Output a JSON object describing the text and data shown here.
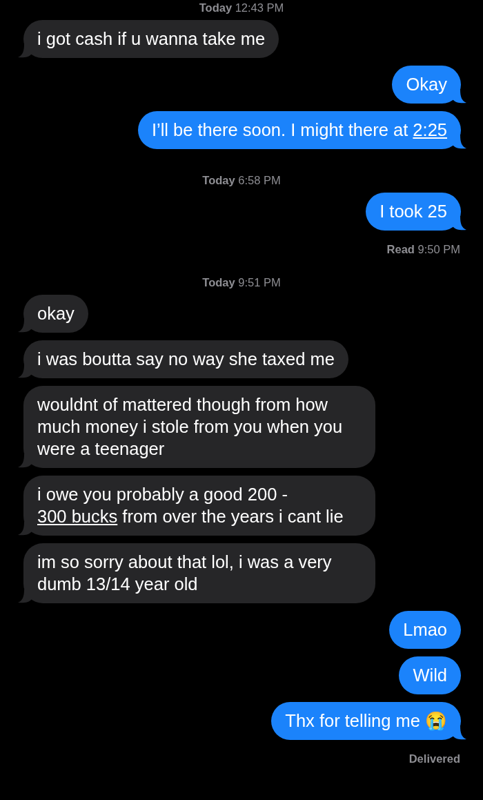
{
  "conversation": [
    {
      "kind": "timestamp",
      "text": "**Today** 12:43 PM"
    },
    {
      "kind": "received_message",
      "tail": true,
      "parts": [
        {
          "text": "i got cash if u wanna take me",
          "link": false
        }
      ]
    },
    {
      "kind": "sent_message",
      "tail": true,
      "parts": [
        {
          "text": "Okay",
          "link": false
        }
      ]
    },
    {
      "kind": "sent_message",
      "tail": true,
      "parts": [
        {
          "text": "I’ll be there soon. I might there at ",
          "link": false
        },
        {
          "text": "2:25",
          "link": true
        }
      ]
    },
    {
      "kind": "timestamp",
      "text": "**Today** 6:58 PM"
    },
    {
      "kind": "sent_message",
      "tail": true,
      "parts": [
        {
          "text": "I took 25",
          "link": false
        }
      ]
    },
    {
      "kind": "receipt",
      "text": "**Read** 9:50 PM"
    },
    {
      "kind": "timestamp",
      "text": "**Today** 9:51 PM"
    },
    {
      "kind": "received_message",
      "tail": true,
      "parts": [
        {
          "text": "okay",
          "link": false
        }
      ]
    },
    {
      "kind": "received_message",
      "tail": true,
      "parts": [
        {
          "text": "i was boutta say no way she taxed me",
          "link": false
        }
      ]
    },
    {
      "kind": "received_message",
      "tail": true,
      "parts": [
        {
          "text": "wouldnt of mattered though from how much money i stole from you when you were a teenager",
          "link": false
        }
      ]
    },
    {
      "kind": "received_message",
      "tail": true,
      "parts": [
        {
          "text": "i owe you probably a good 200 - ",
          "link": false
        },
        {
          "text": "300 bucks",
          "link": true
        },
        {
          "text": " from over the years i cant lie",
          "link": false
        }
      ]
    },
    {
      "kind": "received_message",
      "tail": true,
      "parts": [
        {
          "text": "im so sorry about that lol, i was a very dumb 13/14 year old",
          "link": false
        }
      ]
    },
    {
      "kind": "sent_message",
      "tail": false,
      "parts": [
        {
          "text": "Lmao",
          "link": false
        }
      ]
    },
    {
      "kind": "sent_message",
      "tail": false,
      "parts": [
        {
          "text": "Wild",
          "link": false
        }
      ]
    },
    {
      "kind": "sent_message",
      "tail": true,
      "parts": [
        {
          "text": "Thx for telling me 😭",
          "link": false
        }
      ]
    },
    {
      "kind": "receipt",
      "text": "Delivered"
    }
  ]
}
